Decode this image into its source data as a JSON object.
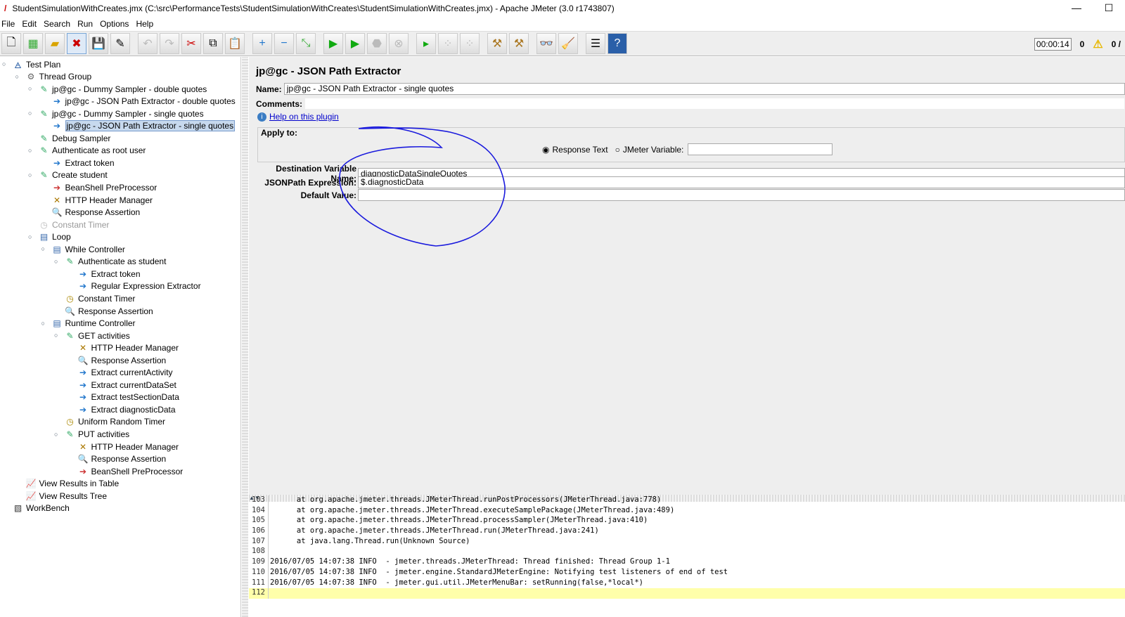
{
  "window": {
    "title": "StudentSimulationWithCreates.jmx (C:\\src\\PerformanceTests\\StudentSimulationWithCreates\\StudentSimulationWithCreates.jmx) - Apache JMeter (3.0 r1743807)",
    "minimize": "—",
    "maximize": "☐"
  },
  "menu": [
    "File",
    "Edit",
    "Search",
    "Run",
    "Options",
    "Help"
  ],
  "toolbar": {
    "timer": "00:00:14",
    "warnings": "0",
    "threads": "0 /"
  },
  "tree": [
    {
      "label": "Test Plan",
      "level": 0,
      "icon": "test-plan"
    },
    {
      "label": "Thread Group",
      "level": 1,
      "icon": "thread-group"
    },
    {
      "label": "jp@gc - Dummy Sampler - double quotes",
      "level": 2,
      "icon": "sampler"
    },
    {
      "label": "jp@gc - JSON Path Extractor - double quotes",
      "level": 3,
      "icon": "extractor"
    },
    {
      "label": "jp@gc - Dummy Sampler - single quotes",
      "level": 2,
      "icon": "sampler"
    },
    {
      "label": "jp@gc - JSON Path Extractor - single quotes",
      "level": 3,
      "icon": "extractor",
      "selected": true
    },
    {
      "label": "Debug Sampler",
      "level": 2,
      "icon": "sampler"
    },
    {
      "label": "Authenticate as root user",
      "level": 2,
      "icon": "sampler"
    },
    {
      "label": "Extract token",
      "level": 3,
      "icon": "extractor"
    },
    {
      "label": "Create student",
      "level": 2,
      "icon": "sampler"
    },
    {
      "label": "BeanShell PreProcessor",
      "level": 3,
      "icon": "preprocessor"
    },
    {
      "label": "HTTP Header Manager",
      "level": 3,
      "icon": "config"
    },
    {
      "label": "Response Assertion",
      "level": 3,
      "icon": "assertion"
    },
    {
      "label": "Constant Timer",
      "level": 2,
      "icon": "timer",
      "disabled": true
    },
    {
      "label": "Loop",
      "level": 2,
      "icon": "controller"
    },
    {
      "label": "While Controller",
      "level": 3,
      "icon": "controller"
    },
    {
      "label": "Authenticate as student",
      "level": 4,
      "icon": "sampler"
    },
    {
      "label": "Extract token",
      "level": 5,
      "icon": "extractor"
    },
    {
      "label": "Regular Expression Extractor",
      "level": 5,
      "icon": "extractor"
    },
    {
      "label": "Constant Timer",
      "level": 4,
      "icon": "timer"
    },
    {
      "label": "Response Assertion",
      "level": 4,
      "icon": "assertion"
    },
    {
      "label": "Runtime Controller",
      "level": 3,
      "icon": "controller"
    },
    {
      "label": "GET activities",
      "level": 4,
      "icon": "sampler"
    },
    {
      "label": "HTTP Header Manager",
      "level": 5,
      "icon": "config"
    },
    {
      "label": "Response Assertion",
      "level": 5,
      "icon": "assertion"
    },
    {
      "label": "Extract currentActivity",
      "level": 5,
      "icon": "extractor"
    },
    {
      "label": "Extract currentDataSet",
      "level": 5,
      "icon": "extractor"
    },
    {
      "label": "Extract testSectionData",
      "level": 5,
      "icon": "extractor"
    },
    {
      "label": "Extract diagnosticData",
      "level": 5,
      "icon": "extractor"
    },
    {
      "label": "Uniform Random Timer",
      "level": 4,
      "icon": "timer"
    },
    {
      "label": "PUT activities",
      "level": 4,
      "icon": "sampler"
    },
    {
      "label": "HTTP Header Manager",
      "level": 5,
      "icon": "config"
    },
    {
      "label": "Response Assertion",
      "level": 5,
      "icon": "assertion"
    },
    {
      "label": "BeanShell PreProcessor",
      "level": 5,
      "icon": "preprocessor"
    },
    {
      "label": "View Results in Table",
      "level": 1,
      "icon": "listener"
    },
    {
      "label": "View Results Tree",
      "level": 1,
      "icon": "listener"
    },
    {
      "label": "WorkBench",
      "level": 0,
      "icon": "workbench"
    }
  ],
  "panel": {
    "title": "jp@gc - JSON Path Extractor",
    "name_label": "Name:",
    "name_value": "jp@gc - JSON Path Extractor - single quotes",
    "comments_label": "Comments:",
    "comments_value": "",
    "help_link": "Help on this plugin",
    "apply_to_label": "Apply to:",
    "radio_response_text": "Response Text",
    "radio_jmeter_variable": "JMeter Variable:",
    "jmeter_variable_value": "",
    "dest_label": "Destination Variable Name:",
    "dest_value": "diagnosticDataSingleQuotes",
    "jsonpath_label": "JSONPath Expression:",
    "jsonpath_value": "$.diagnosticData",
    "default_label": "Default Value:",
    "default_value": "",
    "annotation_color": "#0000dd"
  },
  "log": [
    {
      "n": "103",
      "t": "      at org.apache.jmeter.threads.JMeterThread.runPostProcessors(JMeterThread.java:778)"
    },
    {
      "n": "104",
      "t": "      at org.apache.jmeter.threads.JMeterThread.executeSamplePackage(JMeterThread.java:489)"
    },
    {
      "n": "105",
      "t": "      at org.apache.jmeter.threads.JMeterThread.processSampler(JMeterThread.java:410)"
    },
    {
      "n": "106",
      "t": "      at org.apache.jmeter.threads.JMeterThread.run(JMeterThread.java:241)"
    },
    {
      "n": "107",
      "t": "      at java.lang.Thread.run(Unknown Source)"
    },
    {
      "n": "108",
      "t": ""
    },
    {
      "n": "109",
      "t": "2016/07/05 14:07:38 INFO  - jmeter.threads.JMeterThread: Thread finished: Thread Group 1-1"
    },
    {
      "n": "110",
      "t": "2016/07/05 14:07:38 INFO  - jmeter.engine.StandardJMeterEngine: Notifying test listeners of end of test"
    },
    {
      "n": "111",
      "t": "2016/07/05 14:07:38 INFO  - jmeter.gui.util.JMeterMenuBar: setRunning(false,*local*)"
    },
    {
      "n": "112",
      "t": ""
    }
  ]
}
